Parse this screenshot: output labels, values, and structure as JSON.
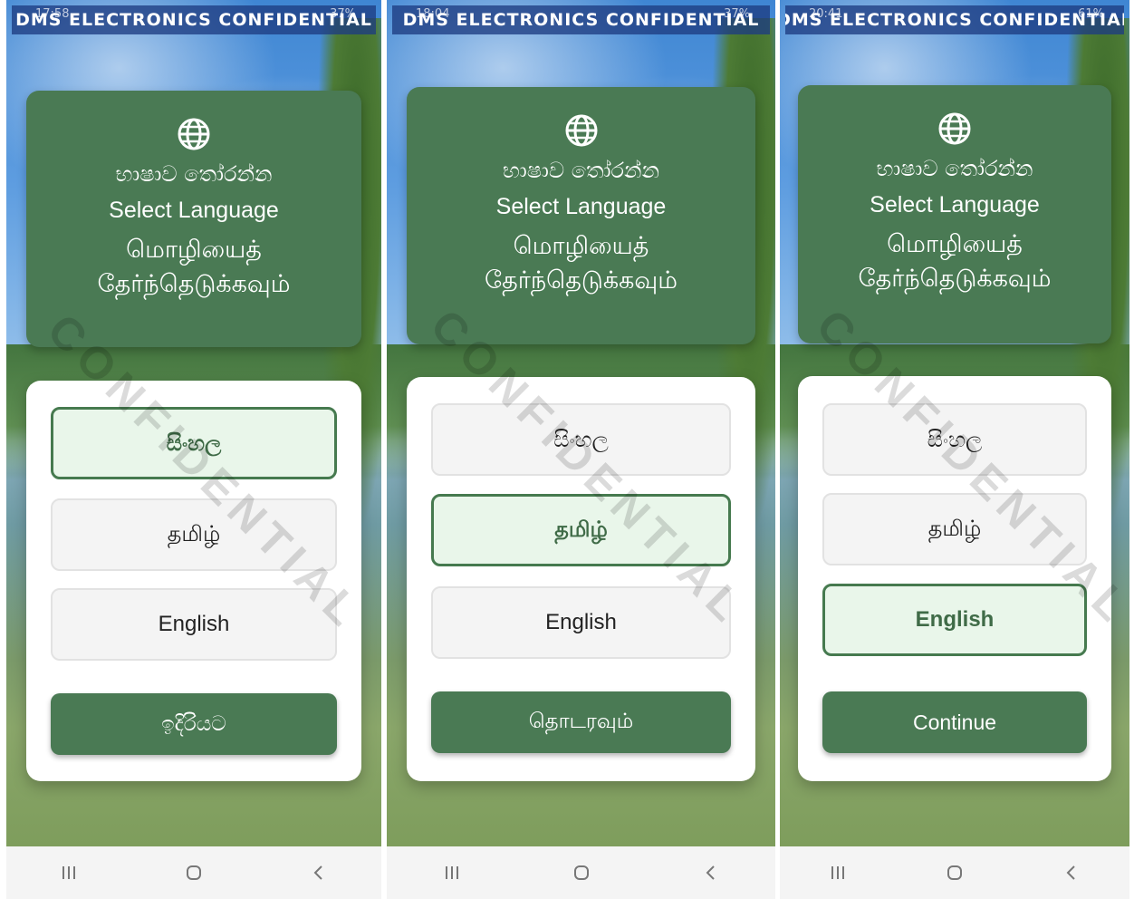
{
  "app": {
    "banner": "DMS ELECTRONICS CONFIDENTIAL",
    "watermark": "CONFIDENTIAL",
    "colors": {
      "primary": "#4a7a54",
      "selected_bg": "#e9f6ea",
      "selected_border": "#467a4f",
      "banner_bg": "#1e3c82"
    }
  },
  "header": {
    "icon": "globe-icon",
    "sinhala": "භාෂාව තෝරන්න",
    "english": "Select Language",
    "tamil": "மொழியைத் தேர்ந்தெடுக்கவும்"
  },
  "options": [
    "සිංහල",
    "தமிழ்",
    "English"
  ],
  "screens": [
    {
      "time": "17:58",
      "battery": "37%",
      "selected": "සිංහල",
      "continue_label": "ඉදිරියට"
    },
    {
      "time": "18:04",
      "battery": "37%",
      "selected": "தமிழ்",
      "continue_label": "தொடரவும்"
    },
    {
      "time": "20:41",
      "battery": "61%",
      "selected": "English",
      "continue_label": "Continue"
    }
  ],
  "navbar": {
    "icons": [
      "recent-apps-icon",
      "home-icon",
      "back-icon"
    ]
  }
}
